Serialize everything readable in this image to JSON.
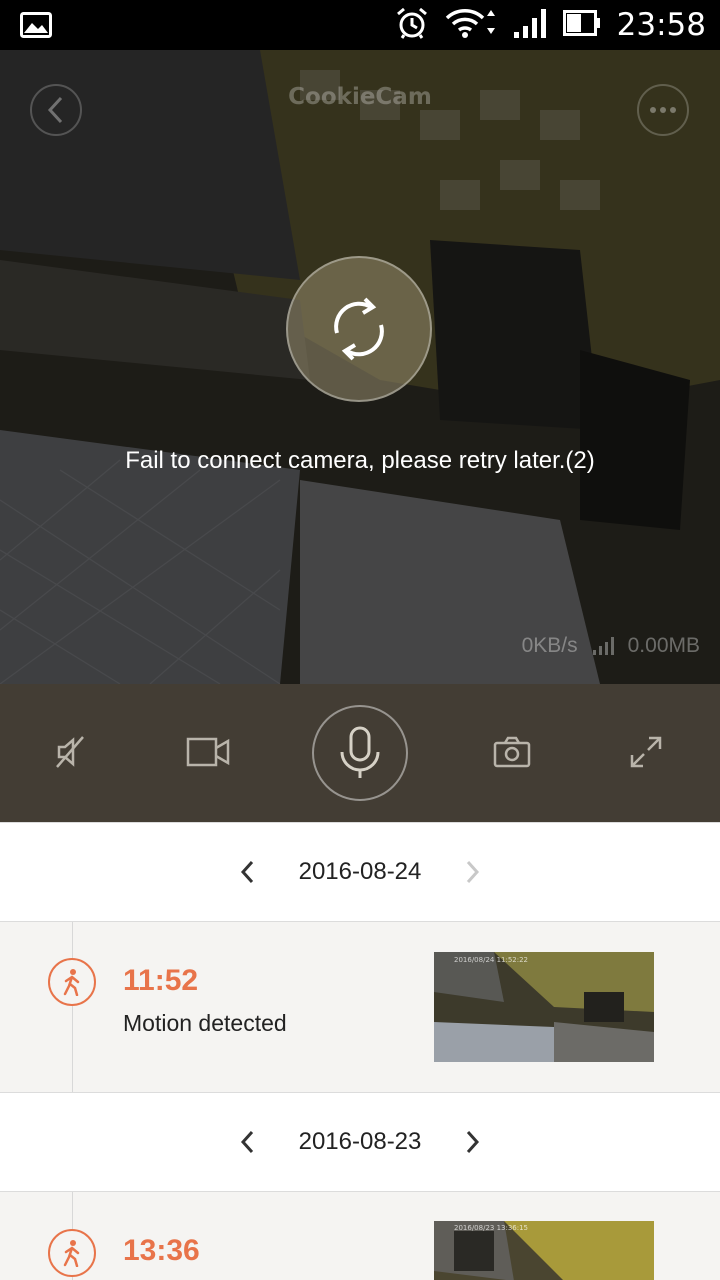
{
  "status_bar": {
    "time": "23:58",
    "icons": [
      "image-notification-icon",
      "alarm-icon",
      "wifi-icon",
      "signal-icon",
      "battery-icon"
    ]
  },
  "camera": {
    "title": "CookieCam",
    "error_message": "Fail to connect camera, please retry later.(2)",
    "speed": "0KB/s",
    "data_used": "0.00MB"
  },
  "controls": {
    "icons": [
      "mute-icon",
      "record-video-icon",
      "microphone-icon",
      "snapshot-camera-icon",
      "fullscreen-icon"
    ]
  },
  "timeline": [
    {
      "date": "2016-08-24",
      "events": [
        {
          "time": "11:52",
          "label": "Motion detected"
        }
      ]
    },
    {
      "date": "2016-08-23",
      "events": [
        {
          "time": "13:36",
          "label": ""
        }
      ]
    }
  ],
  "colors": {
    "accent": "#e8744a",
    "control_bar": "#433d34",
    "status_bar": "#000000"
  }
}
